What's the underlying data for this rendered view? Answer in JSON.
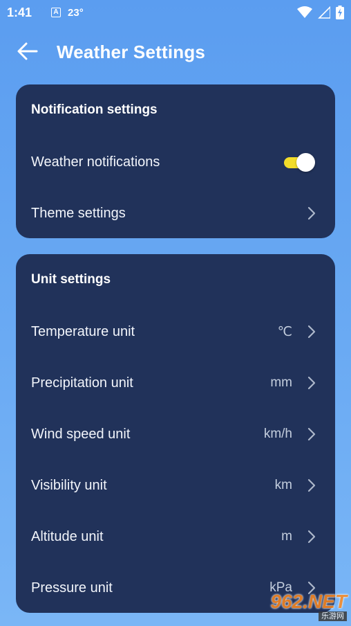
{
  "status_bar": {
    "time": "1:41",
    "notification_icon_letter": "A",
    "temperature": "23°",
    "icons": [
      "wifi-icon",
      "signal-icon",
      "battery-charging-icon"
    ]
  },
  "header": {
    "title": "Weather Settings",
    "back_icon": "arrow-left-icon"
  },
  "notification_card": {
    "title": "Notification settings",
    "weather_notifications": {
      "label": "Weather notifications",
      "enabled": true
    },
    "theme_settings": {
      "label": "Theme settings"
    }
  },
  "unit_card": {
    "title": "Unit settings",
    "rows": [
      {
        "label": "Temperature unit",
        "value": "℃"
      },
      {
        "label": "Precipitation unit",
        "value": "mm"
      },
      {
        "label": "Wind speed unit",
        "value": "km/h"
      },
      {
        "label": "Visibility unit",
        "value": "km"
      },
      {
        "label": "Altitude unit",
        "value": "m"
      },
      {
        "label": "Pressure unit",
        "value": "kPa"
      }
    ]
  },
  "watermark": {
    "brand": "962.NET",
    "sub": "乐游网"
  },
  "colors": {
    "background_top": "#5b9df0",
    "card": "#21325a",
    "toggle_on": "#f2dc2a",
    "value_text": "#c4cede"
  }
}
